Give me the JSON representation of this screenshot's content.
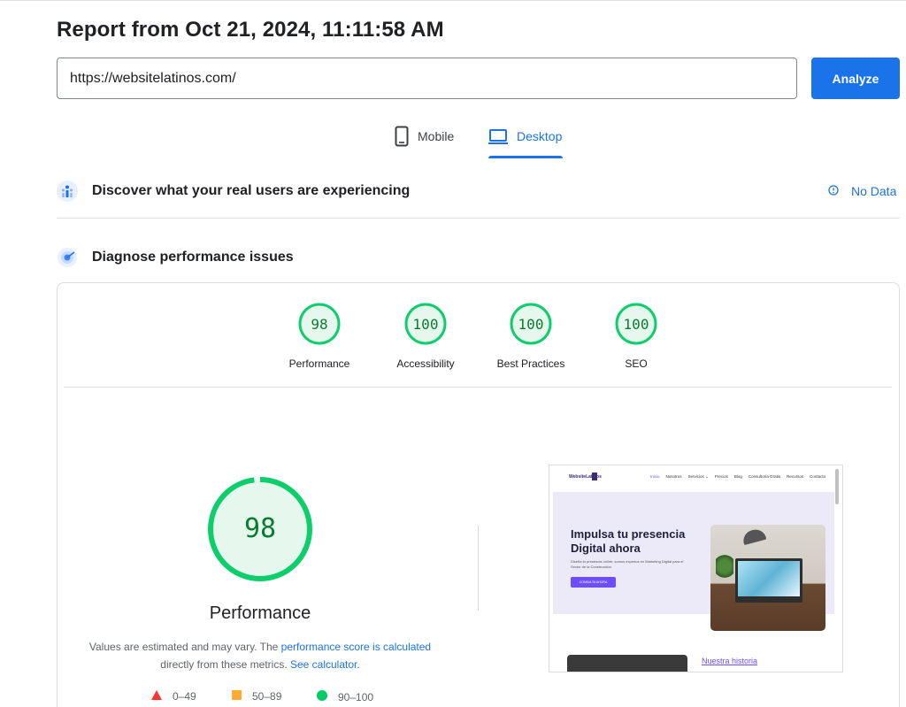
{
  "header": {
    "report_title": "Report from Oct 21, 2024, 11:11:58 AM"
  },
  "search": {
    "url_value": "https://websitelatinos.com/",
    "analyze_label": "Analyze"
  },
  "tabs": [
    {
      "label": "Mobile",
      "icon": "phone-icon",
      "selected": false
    },
    {
      "label": "Desktop",
      "icon": "laptop-icon",
      "selected": true
    }
  ],
  "sections": {
    "field_data": {
      "title": "Discover what your real users are experiencing",
      "icon": "users-data-icon",
      "no_data_label": "No Data"
    },
    "lab_data": {
      "title": "Diagnose performance issues",
      "icon": "radar-icon"
    }
  },
  "scores": [
    {
      "label": "Performance",
      "value": 98
    },
    {
      "label": "Accessibility",
      "value": 100
    },
    {
      "label": "Best Practices",
      "value": 100
    },
    {
      "label": "SEO",
      "value": 100
    }
  ],
  "performance": {
    "score": 98,
    "title": "Performance",
    "desc_prefix": "Values are estimated and may vary. The ",
    "desc_link1": "performance score is calculated",
    "desc_middle": " directly from these metrics. ",
    "desc_link2": "See calculator."
  },
  "legend": [
    {
      "range": "0–49",
      "shape": "triangle",
      "color": "#f33"
    },
    {
      "range": "50–89",
      "shape": "square",
      "color": "#fa3"
    },
    {
      "range": "90–100",
      "shape": "circle",
      "color": "#0c6"
    }
  ],
  "colors": {
    "accent": "#1a73e8",
    "score_good": "#0cce6b",
    "score_good_bg": "#e6f8ee",
    "score_good_text": "#0a7c2f"
  },
  "thumbnail": {
    "logo": "WebsiteLatinos",
    "menu": [
      "Inicio",
      "Nosotros",
      "Servicios ⌄",
      "Precios",
      "Blog",
      "Consultoría Gratis",
      "Recursos",
      "Contacto"
    ],
    "headline_line1": "Impulsa tu presencia",
    "headline_line2": "Digital ahora",
    "body": "Diseña tu presencia online, somos expertos en Marketing Digital para el Sector de la Construcción.",
    "cta": "CONSULTA AHORA",
    "link": "Nuestra historia"
  }
}
